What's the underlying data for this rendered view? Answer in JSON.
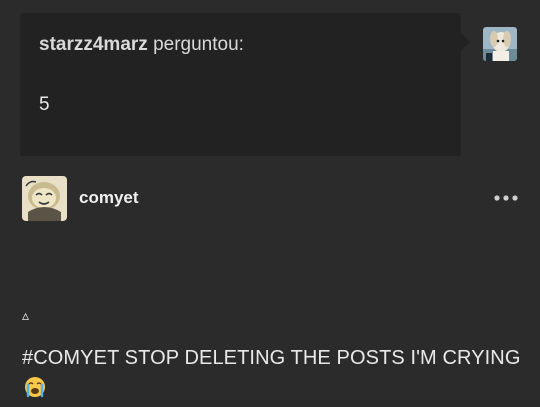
{
  "ask": {
    "asker": "starzz4marz",
    "verb": "perguntou:",
    "question": "5"
  },
  "post": {
    "author": "comyet",
    "glyph": "▵",
    "text": "#COMYET STOP DELETING THE POSTS I'M CRYING"
  },
  "icons": {
    "more": "more-dots-icon",
    "emoji": "loudly-crying-face"
  },
  "colors": {
    "background": "#2b2b2b",
    "bubble": "#222222",
    "text": "#e6e6e6"
  }
}
